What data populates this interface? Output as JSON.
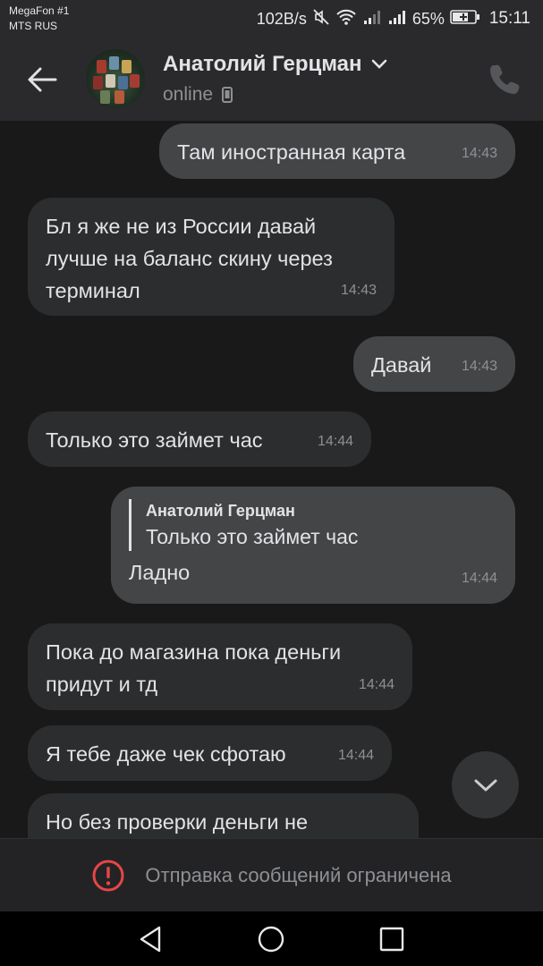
{
  "status_bar": {
    "carrier_1": "MegaFon #1",
    "carrier_2": "MTS RUS",
    "speed": "102B/s",
    "battery": "65%",
    "time": "15:11",
    "icons": [
      "mute-icon",
      "wifi-icon",
      "signal-icon",
      "signal-icon",
      "battery-charging-icon"
    ]
  },
  "header": {
    "name": "Анатолий Герцман",
    "status": "online",
    "icons": [
      "back-arrow-icon",
      "chevron-down-icon",
      "mobile-device-icon",
      "phone-icon"
    ]
  },
  "messages": [
    {
      "dir": "out",
      "text": "Там иностранная карта",
      "time": "14:43"
    },
    {
      "dir": "in",
      "text": "Бл я же не из России давай лучше на баланс скину через терминал",
      "time": "14:43"
    },
    {
      "dir": "out",
      "text": "Давай",
      "time": "14:43"
    },
    {
      "dir": "in",
      "text": "Только это займет час",
      "time": "14:44"
    },
    {
      "dir": "out",
      "reply_author": "Анатолий Герцман",
      "reply_text": "Только это займет час",
      "text": "Ладно",
      "time": "14:44"
    },
    {
      "dir": "in",
      "text": "Пока до магазина пока деньги придут и тд",
      "time": "14:44"
    },
    {
      "dir": "in",
      "text": "Я тебе даже чек сфотаю",
      "time": "14:44"
    },
    {
      "dir": "in",
      "text": "Но без проверки деньги не",
      "time": ""
    }
  ],
  "restriction": {
    "text": "Отправка сообщений ограничена",
    "icon": "warning-icon",
    "accent": "#e64646"
  },
  "navbar": {
    "icons": [
      "nav-back-icon",
      "nav-home-icon",
      "nav-recents-icon"
    ]
  },
  "colors": {
    "background": "#19191a",
    "bubble_in": "#2c2d2e",
    "bubble_out": "#444547",
    "text": "#e1e3e6",
    "secondary_text": "#8d9094"
  }
}
